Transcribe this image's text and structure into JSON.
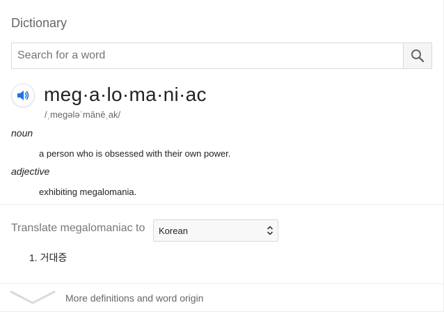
{
  "dictionary": {
    "title": "Dictionary",
    "search": {
      "placeholder": "Search for a word",
      "value": ""
    },
    "entry": {
      "headword": "meg·a·lo·ma·ni·ac",
      "phonetic": "/ˌmeɡələˈmānēˌak/",
      "senses": [
        {
          "pos": "noun",
          "definition": "a person who is obsessed with their own power."
        },
        {
          "pos": "adjective",
          "definition": "exhibiting megalomania."
        }
      ]
    },
    "translate": {
      "label": "Translate megalomaniac to",
      "selected_language": "Korean",
      "results": [
        "1. 거대증"
      ]
    },
    "more": {
      "label": "More definitions and word origin"
    },
    "colors": {
      "speaker_icon": "#1a73e8",
      "search_icon": "#666666"
    }
  }
}
